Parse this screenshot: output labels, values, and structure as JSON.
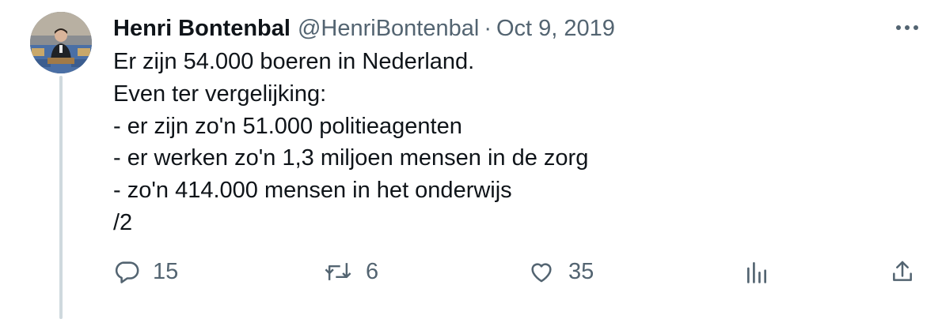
{
  "tweet": {
    "author_name": "Henri Bontenbal",
    "handle": "@HenriBontenbal",
    "separator": "·",
    "date": "Oct 9, 2019",
    "text_lines": [
      "Er zijn 54.000 boeren in Nederland.",
      "Even ter vergelijking:",
      "- er zijn zo'n 51.000 politieagenten",
      "- er werken zo'n 1,3 miljoen mensen in de zorg",
      "- zo'n 414.000 mensen in het onderwijs",
      "/2"
    ]
  },
  "actions": {
    "reply": {
      "icon": "reply-icon",
      "count": "15"
    },
    "retweet": {
      "icon": "retweet-icon",
      "count": "6"
    },
    "like": {
      "icon": "heart-icon",
      "count": "35"
    },
    "views": {
      "icon": "analytics-icon"
    },
    "share": {
      "icon": "share-icon"
    }
  },
  "colors": {
    "text_primary": "#0f1419",
    "text_secondary": "#536471",
    "thread_line": "#cfd9de"
  }
}
